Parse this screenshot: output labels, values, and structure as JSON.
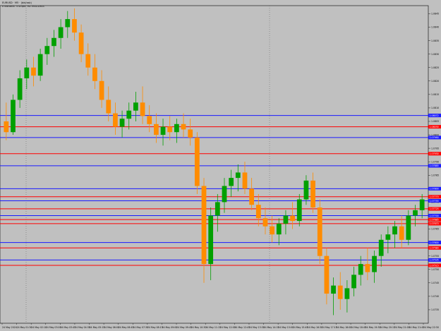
{
  "header": {
    "title": "EURUSD · M5 · (bid/ask)",
    "subtitle": "0 indicators · 0 scripts · EA: Price Action"
  },
  "colors": {
    "background": "#c0c0c0",
    "blue_line": "#1a1aff",
    "red_line": "#ff0000",
    "candle_bull": "#00a000",
    "candle_bear": "#ff8c00",
    "axis_text": "#000000"
  },
  "chart_data": {
    "type": "candlestick",
    "title": "",
    "xlabel": "",
    "ylabel": "",
    "y_range": [
      1.073,
      1.0848
    ],
    "x_ticks": [
      "24 May 2024",
      "24 May 01:30",
      "24 May 02:10",
      "24 May 03:00",
      "24 May 03:45",
      "24 May 04:30",
      "24 May 05:15",
      "24 May 06:00",
      "24 May 06:45",
      "24 May 07:30",
      "24 May 08:15",
      "24 May 09:00",
      "24 May 09:45",
      "24 May 10:30",
      "24 May 11:15",
      "24 May 12:00",
      "24 May 12:45",
      "24 May 13:30",
      "24 May 14:15",
      "24 May 15:00",
      "24 May 15:45",
      "24 May 16:30",
      "24 May 17:15",
      "24 May 18:00",
      "24 May 18:45",
      "24 May 19:30",
      "24 May 20:15",
      "24 May 21:00",
      "24 May 21:45",
      "24 May 22:30"
    ],
    "y_ticks": [
      "1.0845",
      "1.0840",
      "1.0835",
      "1.0830",
      "1.0825",
      "1.0820",
      "1.0815",
      "1.0810",
      "1.0805",
      "1.0800",
      "1.0795",
      "1.0790",
      "1.0785",
      "1.0780",
      "1.0775",
      "1.0770",
      "1.0765",
      "1.0760",
      "1.0755",
      "1.0750",
      "1.0745",
      "1.0740",
      "1.0735"
    ],
    "levels": [
      {
        "price": 1.08072,
        "color": "blue",
        "label": "1.08072"
      },
      {
        "price": 1.0803,
        "color": "red",
        "label": "1.08030"
      },
      {
        "price": 1.0799,
        "color": "blue",
        "label": "1.07990"
      },
      {
        "price": 1.0793,
        "color": "red",
        "label": "1.07930"
      },
      {
        "price": 1.07885,
        "color": "blue",
        "label": "1.07885"
      },
      {
        "price": 1.078,
        "color": "blue",
        "label": "1.07800"
      },
      {
        "price": 1.0777,
        "color": "red",
        "label": "1.07770"
      },
      {
        "price": 1.07755,
        "color": "blue",
        "label": "1.07755"
      },
      {
        "price": 1.07725,
        "color": "red",
        "label": "1.07725"
      },
      {
        "price": 1.077,
        "color": "blue",
        "label": "1.07700"
      },
      {
        "price": 1.07685,
        "color": "red",
        "label": "1.07685"
      },
      {
        "price": 1.0767,
        "color": "red",
        "label": "1.07670"
      },
      {
        "price": 1.076,
        "color": "blue",
        "label": "1.07600"
      },
      {
        "price": 1.0758,
        "color": "red",
        "label": "1.07580"
      },
      {
        "price": 1.07535,
        "color": "blue",
        "label": "1.07535"
      },
      {
        "price": 1.07515,
        "color": "red",
        "label": "1.07515"
      }
    ],
    "candles": [
      {
        "o": 1.0805,
        "h": 1.0812,
        "l": 1.0798,
        "c": 1.0801
      },
      {
        "o": 1.0801,
        "h": 1.0815,
        "l": 1.08,
        "c": 1.0813
      },
      {
        "o": 1.0813,
        "h": 1.0824,
        "l": 1.081,
        "c": 1.0821
      },
      {
        "o": 1.0821,
        "h": 1.0828,
        "l": 1.0817,
        "c": 1.0825
      },
      {
        "o": 1.0825,
        "h": 1.0829,
        "l": 1.0818,
        "c": 1.0822
      },
      {
        "o": 1.0822,
        "h": 1.0832,
        "l": 1.082,
        "c": 1.083
      },
      {
        "o": 1.083,
        "h": 1.0836,
        "l": 1.0826,
        "c": 1.0833
      },
      {
        "o": 1.0833,
        "h": 1.0839,
        "l": 1.0829,
        "c": 1.0836
      },
      {
        "o": 1.0836,
        "h": 1.0843,
        "l": 1.0832,
        "c": 1.084
      },
      {
        "o": 1.084,
        "h": 1.0846,
        "l": 1.0836,
        "c": 1.0843
      },
      {
        "o": 1.0843,
        "h": 1.0847,
        "l": 1.0835,
        "c": 1.0838
      },
      {
        "o": 1.0838,
        "h": 1.0841,
        "l": 1.0827,
        "c": 1.083
      },
      {
        "o": 1.083,
        "h": 1.0834,
        "l": 1.0822,
        "c": 1.0825
      },
      {
        "o": 1.0825,
        "h": 1.083,
        "l": 1.0817,
        "c": 1.082
      },
      {
        "o": 1.082,
        "h": 1.0824,
        "l": 1.081,
        "c": 1.0813
      },
      {
        "o": 1.0813,
        "h": 1.0818,
        "l": 1.0805,
        "c": 1.0808
      },
      {
        "o": 1.0808,
        "h": 1.0812,
        "l": 1.08,
        "c": 1.0803
      },
      {
        "o": 1.0803,
        "h": 1.0809,
        "l": 1.0799,
        "c": 1.0806
      },
      {
        "o": 1.0806,
        "h": 1.0812,
        "l": 1.0802,
        "c": 1.0809
      },
      {
        "o": 1.0809,
        "h": 1.0816,
        "l": 1.0805,
        "c": 1.0812
      },
      {
        "o": 1.0812,
        "h": 1.0818,
        "l": 1.0804,
        "c": 1.0807
      },
      {
        "o": 1.0807,
        "h": 1.0811,
        "l": 1.0801,
        "c": 1.0804
      },
      {
        "o": 1.0804,
        "h": 1.0808,
        "l": 1.0797,
        "c": 1.08
      },
      {
        "o": 1.08,
        "h": 1.0806,
        "l": 1.0796,
        "c": 1.0803
      },
      {
        "o": 1.0803,
        "h": 1.0807,
        "l": 1.0798,
        "c": 1.0801
      },
      {
        "o": 1.0801,
        "h": 1.0806,
        "l": 1.0797,
        "c": 1.0804
      },
      {
        "o": 1.0804,
        "h": 1.0808,
        "l": 1.0799,
        "c": 1.0802
      },
      {
        "o": 1.0802,
        "h": 1.0806,
        "l": 1.0796,
        "c": 1.0799
      },
      {
        "o": 1.0799,
        "h": 1.0801,
        "l": 1.0778,
        "c": 1.0781
      },
      {
        "o": 1.0781,
        "h": 1.0784,
        "l": 1.0745,
        "c": 1.0752
      },
      {
        "o": 1.0752,
        "h": 1.0773,
        "l": 1.0746,
        "c": 1.077
      },
      {
        "o": 1.077,
        "h": 1.0778,
        "l": 1.0764,
        "c": 1.0775
      },
      {
        "o": 1.0775,
        "h": 1.0784,
        "l": 1.0771,
        "c": 1.0781
      },
      {
        "o": 1.0781,
        "h": 1.0787,
        "l": 1.0777,
        "c": 1.0784
      },
      {
        "o": 1.0784,
        "h": 1.0789,
        "l": 1.0779,
        "c": 1.0786
      },
      {
        "o": 1.0786,
        "h": 1.079,
        "l": 1.0778,
        "c": 1.078
      },
      {
        "o": 1.078,
        "h": 1.0784,
        "l": 1.0772,
        "c": 1.0774
      },
      {
        "o": 1.0774,
        "h": 1.0778,
        "l": 1.0766,
        "c": 1.0769
      },
      {
        "o": 1.0769,
        "h": 1.0773,
        "l": 1.0763,
        "c": 1.0766
      },
      {
        "o": 1.0766,
        "h": 1.077,
        "l": 1.076,
        "c": 1.0763
      },
      {
        "o": 1.0763,
        "h": 1.0769,
        "l": 1.0759,
        "c": 1.0767
      },
      {
        "o": 1.0767,
        "h": 1.0772,
        "l": 1.0763,
        "c": 1.077
      },
      {
        "o": 1.077,
        "h": 1.0775,
        "l": 1.0765,
        "c": 1.0768
      },
      {
        "o": 1.0768,
        "h": 1.0778,
        "l": 1.0766,
        "c": 1.0776
      },
      {
        "o": 1.0776,
        "h": 1.0785,
        "l": 1.0774,
        "c": 1.0783
      },
      {
        "o": 1.0783,
        "h": 1.0786,
        "l": 1.0771,
        "c": 1.0773
      },
      {
        "o": 1.0773,
        "h": 1.0776,
        "l": 1.0752,
        "c": 1.0755
      },
      {
        "o": 1.0755,
        "h": 1.0758,
        "l": 1.0737,
        "c": 1.0741
      },
      {
        "o": 1.0741,
        "h": 1.0747,
        "l": 1.0733,
        "c": 1.0744
      },
      {
        "o": 1.0744,
        "h": 1.0749,
        "l": 1.0735,
        "c": 1.0739
      },
      {
        "o": 1.0739,
        "h": 1.0746,
        "l": 1.0734,
        "c": 1.0743
      },
      {
        "o": 1.0743,
        "h": 1.0751,
        "l": 1.074,
        "c": 1.0748
      },
      {
        "o": 1.0748,
        "h": 1.0755,
        "l": 1.0744,
        "c": 1.0752
      },
      {
        "o": 1.0752,
        "h": 1.0758,
        "l": 1.0746,
        "c": 1.0749
      },
      {
        "o": 1.0749,
        "h": 1.0757,
        "l": 1.0745,
        "c": 1.0755
      },
      {
        "o": 1.0755,
        "h": 1.0763,
        "l": 1.0751,
        "c": 1.0761
      },
      {
        "o": 1.0761,
        "h": 1.0766,
        "l": 1.0756,
        "c": 1.0763
      },
      {
        "o": 1.0763,
        "h": 1.0768,
        "l": 1.0758,
        "c": 1.0766
      },
      {
        "o": 1.0766,
        "h": 1.077,
        "l": 1.0758,
        "c": 1.0761
      },
      {
        "o": 1.0761,
        "h": 1.0772,
        "l": 1.0759,
        "c": 1.077
      },
      {
        "o": 1.077,
        "h": 1.0774,
        "l": 1.0766,
        "c": 1.0772
      },
      {
        "o": 1.0772,
        "h": 1.0778,
        "l": 1.0769,
        "c": 1.0776
      }
    ]
  }
}
